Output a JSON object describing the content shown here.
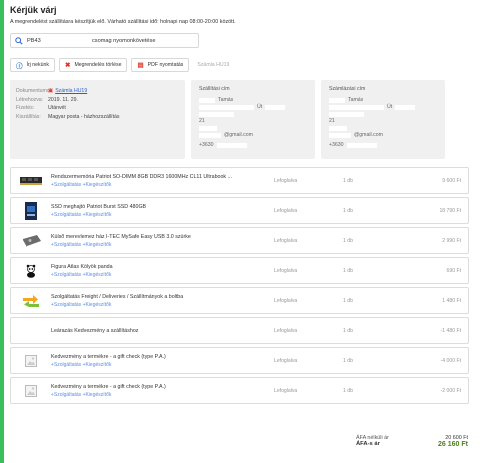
{
  "header": {
    "title": "Kérjük várj",
    "subtitle": "A megrendelést szállításra készítjük elő. Várható szállítási idő: holnapi nap 08:00-20:00 között."
  },
  "search": {
    "value": "PB43",
    "link": "csomag nyomonkövetése"
  },
  "actions": {
    "write_us": "Írj nekünk",
    "delete_order": "Megrendelés törlése",
    "print_pdf": "PDF nyomtatás",
    "invoice": "Számla HU19"
  },
  "document": {
    "document_label": "Dokumentumok",
    "document_value": "Számla HU19",
    "created_label": "Létrehozva:",
    "created_value": "2019. 11. 29.",
    "payment_label": "Fizetés:",
    "payment_value": "Utánvét",
    "shipping_label": "Kiszállítás:",
    "shipping_value": "Magyar posta - házhozszállítás"
  },
  "shipping_address": {
    "title": "Szállítási cím",
    "name": "Tamás",
    "street": "Út",
    "number": "21",
    "email": "@gmail.com",
    "phone": "+3630"
  },
  "billing_address": {
    "title": "Számlázási cím",
    "name": "Tamás",
    "street": "Út",
    "number": "21",
    "email": "@gmail.com",
    "phone": "+3630"
  },
  "item_links": {
    "services": "+Szolgáltatás",
    "accessories": "+Kiegészítők"
  },
  "items": [
    {
      "name": "Rendszermemória Patriot SO-DIMM 8GB DDR3 1600MHz CL11 Ultrabook ...",
      "status": "Lefoglalva",
      "qty": "1 db",
      "price": "9 600 Ft",
      "icon": "ram-module-icon"
    },
    {
      "name": "SSD meghajtó Patriot Burst SSD 480GB",
      "status": "Lefoglalva",
      "qty": "1 db",
      "price": "18 790 Ft",
      "icon": "ssd-icon"
    },
    {
      "name": "Külső merevlemez ház I-TEC MySafe Easy USB 3.0 szürke",
      "status": "Lefoglalva",
      "qty": "1 db",
      "price": "2 990 Ft",
      "icon": "hdd-enclosure-icon"
    },
    {
      "name": "Figura Atlas Kölyök panda",
      "status": "Lefoglalva",
      "qty": "1 db",
      "price": "690 Ft",
      "icon": "panda-figure-icon"
    },
    {
      "name": "Szolgáltatás Freight / Deliveries / Szállítmányok a boltba",
      "status": "Lefoglalva",
      "qty": "1 db",
      "price": "1 480 Ft",
      "icon": "exchange-arrows-icon"
    },
    {
      "name": "Leárazás Kedvezmény a szállításhoz",
      "status": "Lefoglalva",
      "qty": "1 db",
      "price": "-1 480 Ft",
      "icon": ""
    },
    {
      "name": "Kedvezmény a termékre - a gift check (type P.A.)",
      "status": "Lefoglalva",
      "qty": "1 db",
      "price": "-4 000 Ft",
      "icon": "image-placeholder-icon"
    },
    {
      "name": "Kedvezmény a termékre - a gift check (type P.A.)",
      "status": "Lefoglalva",
      "qty": "1 db",
      "price": "-2 000 Ft",
      "icon": "image-placeholder-icon"
    }
  ],
  "totals": {
    "net_label": "ÁFA nélküli ár",
    "net_value": "20 600 Ft",
    "gross_label": "ÁFA-s ár",
    "gross_value": "26 160 Ft"
  },
  "colors": {
    "accent": "#3bbf5c",
    "link": "#5b8fe0",
    "total_green": "#4e7f1e",
    "delete_red": "#e0302a"
  }
}
